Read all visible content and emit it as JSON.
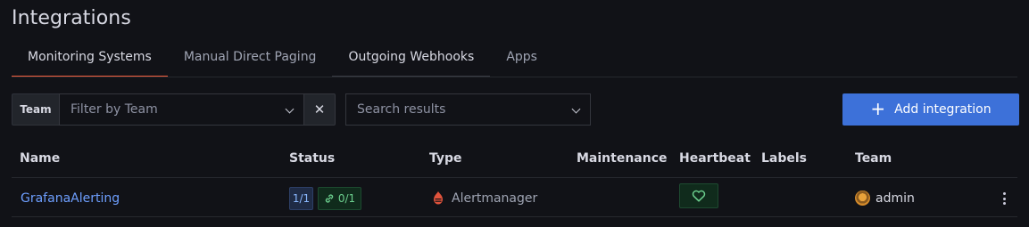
{
  "page": {
    "title": "Integrations"
  },
  "tabs": [
    {
      "label": "Monitoring Systems",
      "active": true
    },
    {
      "label": "Manual Direct Paging",
      "active": false
    },
    {
      "label": "Outgoing Webhooks",
      "active": false
    },
    {
      "label": "Apps",
      "active": false
    }
  ],
  "filters": {
    "team_label": "Team",
    "team_placeholder": "Filter by Team",
    "search_placeholder": "Search results",
    "clear_icon": "close-icon"
  },
  "actions": {
    "add_integration_label": "Add integration",
    "add_icon": "plus-icon"
  },
  "table": {
    "columns": [
      "Name",
      "Status",
      "Type",
      "Maintenance",
      "Heartbeat",
      "Labels",
      "Team"
    ],
    "rows": [
      {
        "name": "GrafanaAlerting",
        "status_count": "1/1",
        "status_connected": "0/1",
        "type": "Alertmanager",
        "type_icon": "alertmanager-icon",
        "maintenance": "",
        "heartbeat_icon": "heart-icon",
        "labels": "",
        "team": "admin"
      }
    ]
  },
  "colors": {
    "accent": "#3d71d9",
    "active_tab_underline": "#f55f3e",
    "link": "#6e9fff",
    "success": "#6ccf8e",
    "background": "#111217"
  }
}
